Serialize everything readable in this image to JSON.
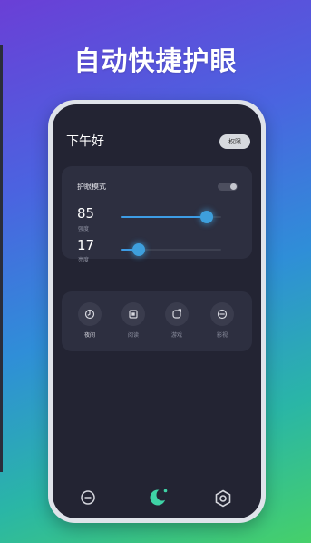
{
  "headline": "自动快捷护眼",
  "app": {
    "greeting": "下午好",
    "permission_button": "权限"
  },
  "eye_protection": {
    "label": "护眼模式",
    "toggle_on": false,
    "intensity": {
      "value": "85",
      "label": "强度",
      "level": 0.85
    },
    "brightness": {
      "value": "17",
      "label": "亮度",
      "level": 0.17
    }
  },
  "modes": [
    {
      "label": "夜间",
      "icon": "night-mode-icon",
      "active": true
    },
    {
      "label": "阅读",
      "icon": "reading-mode-icon",
      "active": false
    },
    {
      "label": "游戏",
      "icon": "game-mode-icon",
      "active": false
    },
    {
      "label": "影视",
      "icon": "video-mode-icon",
      "active": false
    }
  ],
  "bottom_nav": [
    {
      "icon": "minus-circle-icon",
      "active": false
    },
    {
      "icon": "moon-icon",
      "active": true
    },
    {
      "icon": "settings-hexagon-icon",
      "active": false
    }
  ],
  "colors": {
    "accent": "#3e9fdc",
    "screen_bg": "#232433",
    "card_bg": "#2d2f40",
    "active_nav": "#3fd3a6"
  }
}
